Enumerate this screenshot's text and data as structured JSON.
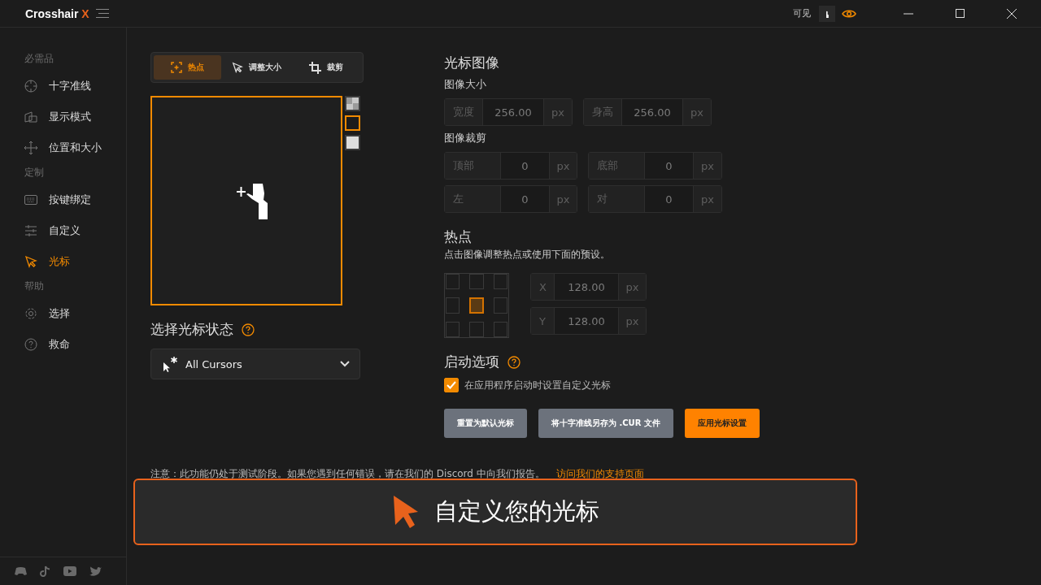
{
  "window": {
    "title": "Crosshair",
    "title_mark": "X",
    "visible_label": "可见"
  },
  "sidebar": {
    "sections": [
      {
        "heading": "必需品",
        "items": [
          {
            "label": "十字准线",
            "kind": "crosshair",
            "selected": false
          },
          {
            "label": "显示模式",
            "kind": "display",
            "selected": false
          },
          {
            "label": "位置和大小",
            "kind": "move",
            "selected": false
          }
        ]
      },
      {
        "heading": "定制",
        "items": [
          {
            "label": "按键绑定",
            "kind": "keyboard",
            "selected": false
          },
          {
            "label": "自定义",
            "kind": "sliders",
            "selected": false
          },
          {
            "label": "光标",
            "kind": "cursor",
            "selected": true
          }
        ]
      },
      {
        "heading": "帮助",
        "items": [
          {
            "label": "选择",
            "kind": "gear",
            "selected": false
          },
          {
            "label": "救命",
            "kind": "help",
            "selected": false
          }
        ]
      }
    ]
  },
  "tabs": [
    {
      "label": "热点",
      "kind": "hotspot",
      "selected": true
    },
    {
      "label": "调整大小",
      "kind": "cursor",
      "selected": false
    },
    {
      "label": "裁剪",
      "kind": "crop",
      "selected": false
    }
  ],
  "backgrounds": [
    {
      "kind": "checker",
      "selected": false
    },
    {
      "kind": "dark",
      "selected": true
    },
    {
      "kind": "light",
      "selected": false
    }
  ],
  "cursor_state": {
    "heading": "选择光标状态",
    "value": "All Cursors"
  },
  "image": {
    "heading": "光标图像",
    "size_heading": "图像大小",
    "size_fields": [
      {
        "label": "宽度",
        "value": "256.00",
        "unit": "px"
      },
      {
        "label": "身高",
        "value": "256.00",
        "unit": "px"
      }
    ],
    "crop_heading": "图像裁剪",
    "crop_fields": [
      {
        "label": "顶部",
        "value": "0",
        "unit": "px"
      },
      {
        "label": "底部",
        "value": "0",
        "unit": "px"
      },
      {
        "label": "左",
        "value": "0",
        "unit": "px"
      },
      {
        "label": "对",
        "value": "0",
        "unit": "px"
      }
    ]
  },
  "hotspot": {
    "heading": "热点",
    "description": "点击图像调整热点或使用下面的预设。",
    "presets": [
      {
        "selected": false
      },
      {
        "selected": false
      },
      {
        "selected": false
      },
      {
        "selected": false
      },
      {
        "selected": true
      },
      {
        "selected": false
      },
      {
        "selected": false
      },
      {
        "selected": false
      },
      {
        "selected": false
      }
    ],
    "fields": [
      {
        "label": "X",
        "value": "128.00",
        "unit": "px"
      },
      {
        "label": "Y",
        "value": "128.00",
        "unit": "px"
      }
    ]
  },
  "startup": {
    "heading": "启动选项",
    "checkbox": {
      "label": "在应用程序启动时设置自定义光标",
      "checked": true
    }
  },
  "buttons": [
    {
      "label": "重置为默认光标",
      "kind": "secondary"
    },
    {
      "label": "将十字准线另存为 .CUR 文件",
      "kind": "secondary"
    },
    {
      "label": "应用光标设置",
      "kind": "primary"
    }
  ],
  "note": {
    "text": "注意：此功能仍处于测试阶段。如果您遇到任何错误，请在我们的 Discord 中向我们报告。",
    "link": "访问我们的支持页面"
  },
  "banner": {
    "text": "自定义您的光标"
  }
}
